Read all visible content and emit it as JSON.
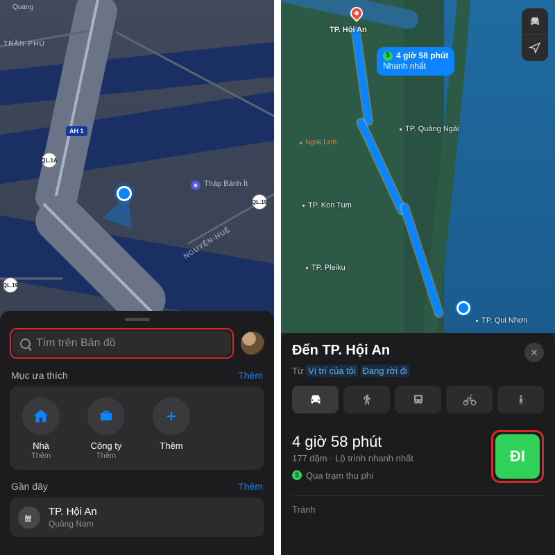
{
  "left": {
    "map": {
      "labels": {
        "quang": "Quang",
        "tranphu": "TRẦN-PHÚ",
        "ah1": "AH 1",
        "ql1a": "QL.1A",
        "ql19_a": "QL.19",
        "ql19_b": "QL.19",
        "nguyenhue": "NGUYỄN-HUỆ",
        "poi_star": "Tháp Bánh Ít"
      }
    },
    "sheet": {
      "search_placeholder": "Tìm trên Bản đồ",
      "favorites_title": "Mục ưa thích",
      "more": "Thêm",
      "fav": [
        {
          "label": "Nhà",
          "sub": "Thêm"
        },
        {
          "label": "Công ty",
          "sub": "Thêm"
        },
        {
          "label": "Thêm",
          "sub": ""
        }
      ],
      "recent_title": "Gần đây",
      "recent": {
        "title": "TP. Hội An",
        "sub": "Quảng Nam"
      }
    }
  },
  "right": {
    "map": {
      "cities": {
        "hoian": "TP. Hội An",
        "quangngai": "TP. Quảng Ngãi",
        "kontum": "TP. Kon Tum",
        "pleiku": "TP. Pleiku",
        "quinhon": "TP. Qui Nhơn",
        "ngoklinh": "Ngok Linh"
      },
      "eta_bubble": {
        "time": "4 giờ 58 phút",
        "tag": "Nhanh nhất"
      }
    },
    "sheet": {
      "dest_title": "Đến TP. Hội An",
      "from_prefix": "Từ",
      "from_loc": "Vị trí của tôi",
      "from_status": "Đang rời đi",
      "eta_main": "4 giờ 58 phút",
      "eta_sub": "177 dặm · Lộ trình nhanh nhất",
      "toll": "Qua trạm thu phí",
      "go": "ĐI",
      "avoid": "Tránh"
    }
  }
}
